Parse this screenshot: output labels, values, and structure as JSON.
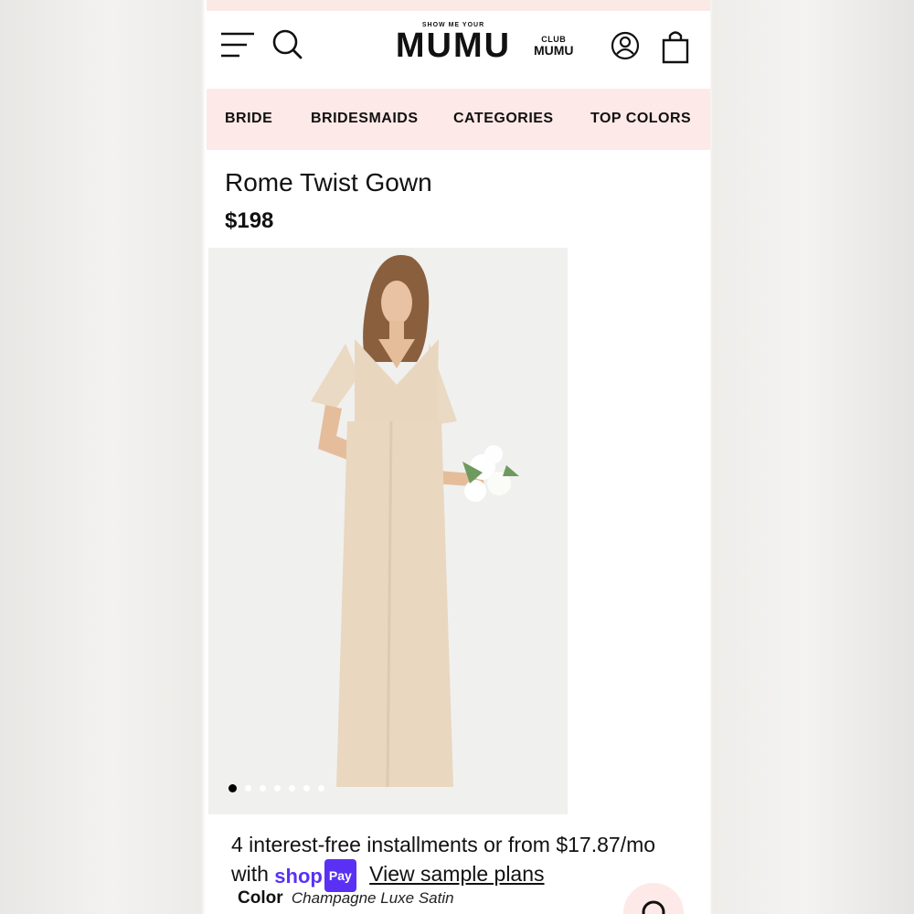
{
  "header": {
    "brand_small": "SHOW ME YOUR",
    "brand_name": "MUMU",
    "club_small": "CLUB",
    "club_name": "MUMU"
  },
  "nav": {
    "items": [
      {
        "label": "BRIDE"
      },
      {
        "label": "BRIDESMAIDS"
      },
      {
        "label": "CATEGORIES"
      },
      {
        "label": "TOP COLORS"
      }
    ]
  },
  "product": {
    "title": "Rome Twist Gown",
    "price": "$198",
    "image_count": 7,
    "active_image_index": 0
  },
  "payment": {
    "line1": "4 interest-free installments or from $17.87/mo",
    "with": "with",
    "shop_word": "shop",
    "pay_word": "Pay",
    "link": "View sample plans"
  },
  "color": {
    "label": "Color",
    "value": "Champagne Luxe Satin"
  },
  "colors": {
    "accent_pink": "#fde9e7",
    "shop_pay_purple": "#5a31f4",
    "gown": "#e9d7c0"
  },
  "icons": [
    "menu-icon",
    "search-icon",
    "account-icon",
    "shopping-bag-icon",
    "chat-icon"
  ]
}
